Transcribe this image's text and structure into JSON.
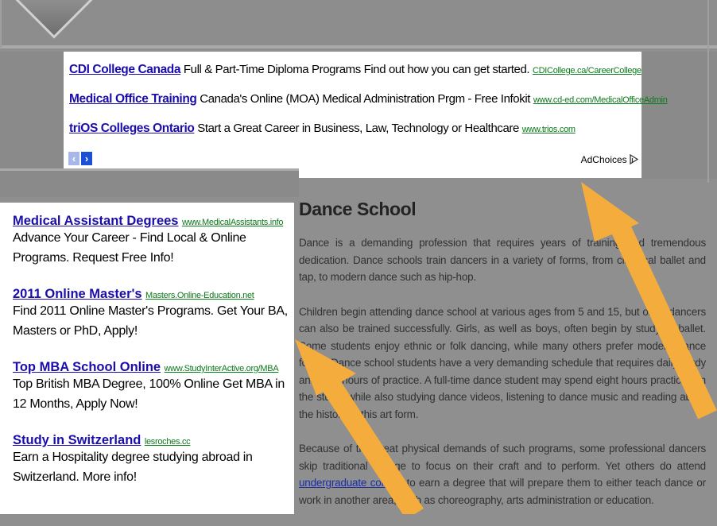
{
  "top_ads": [
    {
      "title": "CDI College Canada",
      "text": "Full & Part-Time Diploma Programs Find out how you can get started.",
      "url": "CDICollege.ca/CareerCollege"
    },
    {
      "title": "Medical Office Training",
      "text": "Canada's Online (MOA) Medical Administration Prgm - Free Infokit",
      "url": "www.cd-ed.com/MedicalOfficeAdmin"
    },
    {
      "title": "triOS Colleges Ontario",
      "text": "Start a Great Career in Business, Law, Technology or Healthcare",
      "url": "www.trios.com"
    }
  ],
  "pager": {
    "prev": "‹",
    "next": "›"
  },
  "adchoices": {
    "label": "AdChoices",
    "icon": "adchoices-icon"
  },
  "left_ads": [
    {
      "title": "Medical Assistant Degrees",
      "url": "www.MedicalAssistants.info",
      "desc": "Advance Your Career - Find Local & Online Programs. Request Free Info!"
    },
    {
      "title": "2011 Online Master's",
      "url": "Masters.Online-Education.net",
      "desc": "Find 2011 Online Master's Programs. Get Your BA, Masters or PhD, Apply!"
    },
    {
      "title": "Top MBA School Online",
      "url": "www.StudyInterActive.org/MBA",
      "desc": "Top British MBA Degree, 100% Online Get MBA in 12 Months, Apply Now!"
    },
    {
      "title": "Study in Switzerland",
      "url": "lesroches.cc",
      "desc": "Earn a Hospitality degree studying abroad in Switzerland. More info!"
    }
  ],
  "article": {
    "title": "Dance School",
    "p1": "Dance is a demanding profession that requires years of training and tremendous dedication. Dance schools train dancers in a variety of forms, from classical ballet and tap, to modern dance such as hip-hop.",
    "p2": "Children begin attending dance school at various ages from 5 and 15, but older dancers can also be trained successfully. Girls, as well as boys, often begin by studying ballet. Some students enjoy ethnic or folk dancing, while many others prefer modern dance forms. Dance school students have a very demanding schedule that requires daily study and long hours of practice. A full-time dance student may spend eight hours practicing in the studio while also studying dance videos, listening to dance music and reading about the history of this art form.",
    "p3_before": "Because of the great physical demands of such programs, some professional dancers skip traditional college to focus on their craft and to perform. Yet others do attend ",
    "p3_link": "undergraduate college",
    "p3_after": " to earn a degree that will prepare them to either teach dance or work in another area, such as choreography, arts administration or education."
  },
  "colors": {
    "arrow": "#f4ad3c",
    "ad_title": "#1a0dab",
    "ad_url": "#0a7a1a"
  }
}
